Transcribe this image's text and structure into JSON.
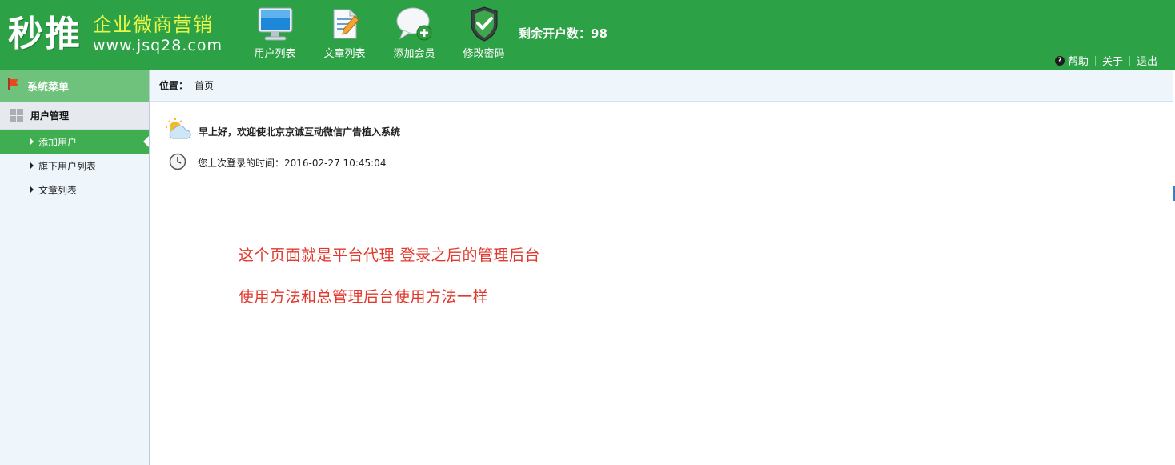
{
  "header": {
    "logo_main": "秒推",
    "logo_slogan": "企业微商营销",
    "logo_url": "www.jsq28.com",
    "nav": [
      {
        "label": "用户列表",
        "icon": "monitor-icon"
      },
      {
        "label": "文章列表",
        "icon": "document-edit-icon"
      },
      {
        "label": "添加会员",
        "icon": "chat-add-icon"
      },
      {
        "label": "修改密码",
        "icon": "shield-check-icon"
      }
    ],
    "account_label": "剩余开户数：",
    "account_value": "98",
    "links": {
      "help": "帮助",
      "about": "关于",
      "logout": "退出"
    }
  },
  "sidebar": {
    "title": "系统菜单",
    "group": "用户管理",
    "items": [
      {
        "label": "添加用户",
        "active": true
      },
      {
        "label": "旗下用户列表",
        "active": false
      },
      {
        "label": "文章列表",
        "active": false
      }
    ]
  },
  "breadcrumb": {
    "label": "位置：",
    "current": "首页"
  },
  "main": {
    "welcome": "早上好，欢迎使北京京诚互动微信广告植入系统",
    "last_login": "您上次登录的时间：2016-02-27 10:45:04",
    "note_line1": "这个页面就是平台代理 登录之后的管理后台",
    "note_line2": "使用方法和总管理后台使用方法一样"
  },
  "colors": {
    "header_green": "#2da145",
    "menu_active": "#3eae50",
    "note_red": "#e03a2e",
    "slogan_yellow": "#e8f64a"
  }
}
